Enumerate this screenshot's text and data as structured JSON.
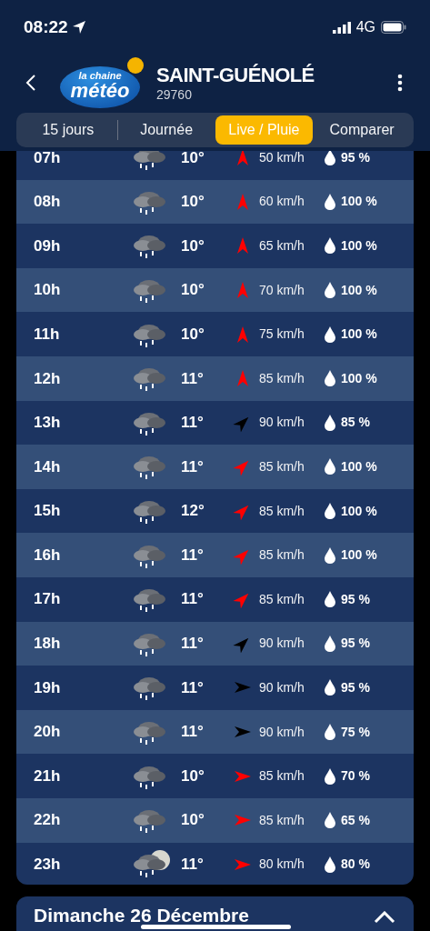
{
  "status_bar": {
    "time": "08:22",
    "network": "4G"
  },
  "header": {
    "city": "SAINT-GUÉNOLÉ",
    "postcode": "29760",
    "logo": {
      "top": "la chaine",
      "bottom": "météo"
    }
  },
  "tabs": [
    {
      "label": "15 jours",
      "selected": false
    },
    {
      "label": "Journée",
      "selected": false
    },
    {
      "label": "Live / Pluie",
      "selected": true
    },
    {
      "label": "Comparer",
      "selected": false
    }
  ],
  "hours": [
    {
      "hour": "07h",
      "kind": "rain",
      "temp": "10°",
      "wind": {
        "kind": "north",
        "color": "#ff0000",
        "speed": "50 km/h"
      },
      "rain": "95 %"
    },
    {
      "hour": "08h",
      "kind": "rain",
      "temp": "10°",
      "wind": {
        "kind": "north",
        "color": "#ff0000",
        "speed": "60 km/h"
      },
      "rain": "100 %"
    },
    {
      "hour": "09h",
      "kind": "rain",
      "temp": "10°",
      "wind": {
        "kind": "north",
        "color": "#ff0000",
        "speed": "65 km/h"
      },
      "rain": "100 %"
    },
    {
      "hour": "10h",
      "kind": "rain",
      "temp": "10°",
      "wind": {
        "kind": "north",
        "color": "#ff0000",
        "speed": "70 km/h"
      },
      "rain": "100 %"
    },
    {
      "hour": "11h",
      "kind": "rain",
      "temp": "10°",
      "wind": {
        "kind": "north",
        "color": "#ff0000",
        "speed": "75 km/h"
      },
      "rain": "100 %"
    },
    {
      "hour": "12h",
      "kind": "rain",
      "temp": "11°",
      "wind": {
        "kind": "north",
        "color": "#ff0000",
        "speed": "85 km/h"
      },
      "rain": "100 %"
    },
    {
      "hour": "13h",
      "kind": "rain",
      "temp": "11°",
      "wind": {
        "kind": "northeast",
        "color": "#000000",
        "speed": "90 km/h"
      },
      "rain": "85 %"
    },
    {
      "hour": "14h",
      "kind": "rain",
      "temp": "11°",
      "wind": {
        "kind": "northeast",
        "color": "#ff0000",
        "speed": "85 km/h"
      },
      "rain": "100 %"
    },
    {
      "hour": "15h",
      "kind": "rain",
      "temp": "12°",
      "wind": {
        "kind": "northeast",
        "color": "#ff0000",
        "speed": "85 km/h"
      },
      "rain": "100 %"
    },
    {
      "hour": "16h",
      "kind": "rain",
      "temp": "11°",
      "wind": {
        "kind": "northeast",
        "color": "#ff0000",
        "speed": "85 km/h"
      },
      "rain": "100 %"
    },
    {
      "hour": "17h",
      "kind": "rain",
      "temp": "11°",
      "wind": {
        "kind": "northeast",
        "color": "#ff0000",
        "speed": "85 km/h"
      },
      "rain": "95 %"
    },
    {
      "hour": "18h",
      "kind": "rain",
      "temp": "11°",
      "wind": {
        "kind": "northeast",
        "color": "#000000",
        "speed": "90 km/h"
      },
      "rain": "95 %"
    },
    {
      "hour": "19h",
      "kind": "rain",
      "temp": "11°",
      "wind": {
        "kind": "east",
        "color": "#000000",
        "speed": "90 km/h"
      },
      "rain": "95 %"
    },
    {
      "hour": "20h",
      "kind": "rain",
      "temp": "11°",
      "wind": {
        "kind": "east",
        "color": "#000000",
        "speed": "90 km/h"
      },
      "rain": "75 %"
    },
    {
      "hour": "21h",
      "kind": "rain",
      "temp": "10°",
      "wind": {
        "kind": "east",
        "color": "#ff0000",
        "speed": "85 km/h"
      },
      "rain": "70 %"
    },
    {
      "hour": "22h",
      "kind": "rain",
      "temp": "10°",
      "wind": {
        "kind": "east",
        "color": "#ff0000",
        "speed": "85 km/h"
      },
      "rain": "65 %"
    },
    {
      "hour": "23h",
      "kind": "night-rain",
      "temp": "11°",
      "wind": {
        "kind": "east",
        "color": "#ff0000",
        "speed": "80 km/h"
      },
      "rain": "80 %"
    }
  ],
  "next_day": {
    "title": "Dimanche 26 Décembre",
    "expanded": true
  }
}
